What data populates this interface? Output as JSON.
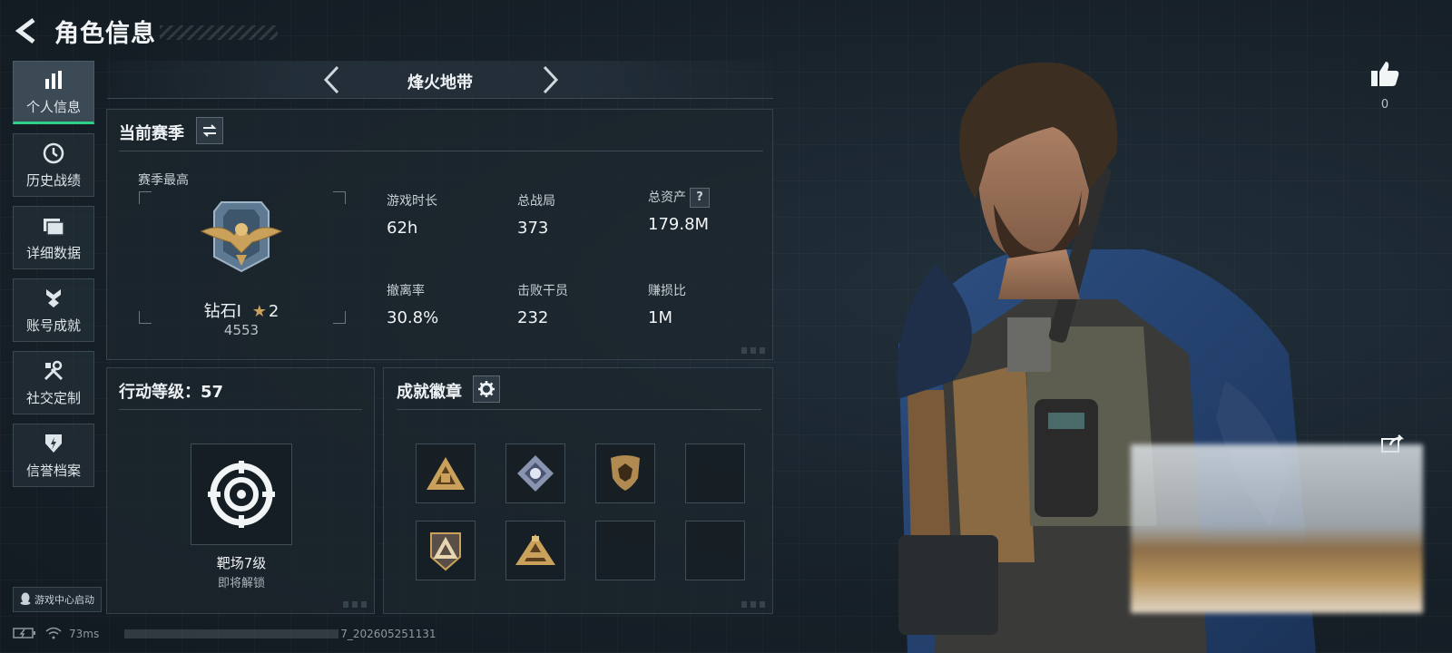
{
  "header": {
    "title": "角色信息"
  },
  "sidebar": {
    "items": [
      {
        "label": "个人信息",
        "icon": "bar-chart-icon",
        "active": true
      },
      {
        "label": "历史战绩",
        "icon": "history-icon",
        "active": false
      },
      {
        "label": "详细数据",
        "icon": "folder-icon",
        "active": false
      },
      {
        "label": "账号成就",
        "icon": "medal-icon",
        "active": false
      },
      {
        "label": "社交定制",
        "icon": "tools-icon",
        "active": false
      },
      {
        "label": "信誉档案",
        "icon": "shield-icon",
        "active": false
      }
    ],
    "game_center": "游戏中心启动"
  },
  "mode": {
    "name": "烽火地带"
  },
  "season": {
    "title": "当前赛季",
    "best_label": "赛季最高",
    "rank": "钻石I",
    "stars": "2",
    "score": "4553",
    "stats": [
      {
        "label": "游戏时长",
        "value": "62h"
      },
      {
        "label": "总战局",
        "value": "373"
      },
      {
        "label": "总资产",
        "value": "179.8M",
        "help": "?"
      },
      {
        "label": "撤离率",
        "value": "30.8%"
      },
      {
        "label": "击败干员",
        "value": "232"
      },
      {
        "label": "赚损比",
        "value": "1M"
      }
    ]
  },
  "action_level": {
    "title": "行动等级：57",
    "target_name": "靶场7级",
    "target_status": "即将解锁"
  },
  "achievements": {
    "title": "成就徽章",
    "badges": [
      "triangle-squad-badge",
      "diamond-gear-badge",
      "shield-crest-badge",
      "empty",
      "triangle-shield-badge",
      "pyramid-crest-badge",
      "empty",
      "empty"
    ]
  },
  "social": {
    "likes": "0"
  },
  "status_bar": {
    "ping": "73ms",
    "build": "7_202605251131"
  },
  "colors": {
    "accent": "#2fd08a",
    "panel_border": "#34424d",
    "gold": "#c9a15a"
  }
}
